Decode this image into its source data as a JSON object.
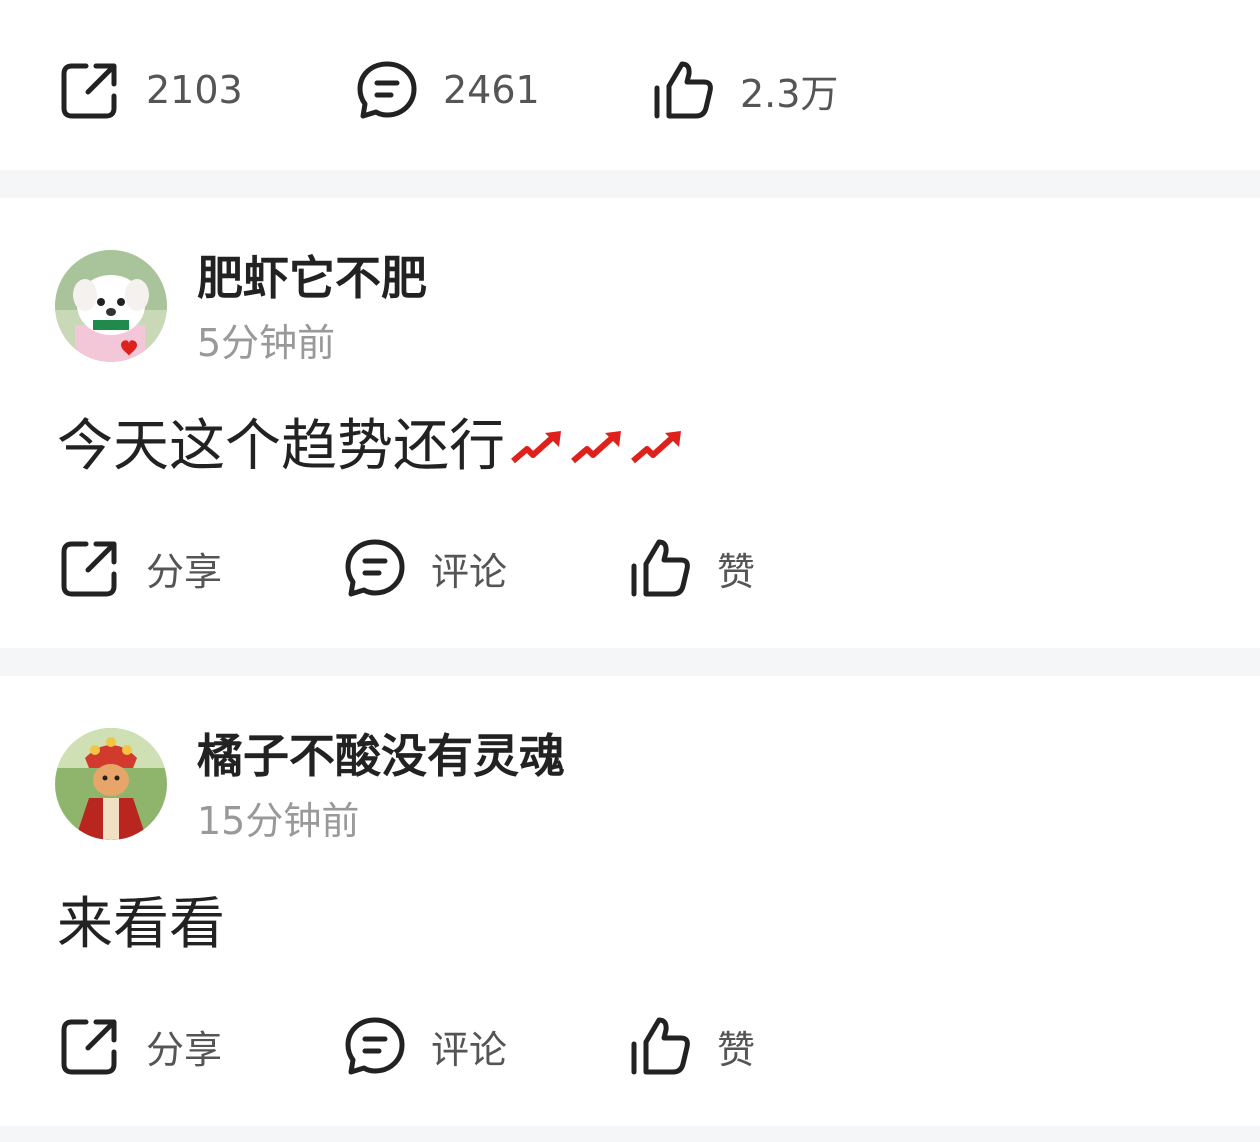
{
  "top_actions": {
    "share": "2103",
    "comment": "2461",
    "like": "2.3万"
  },
  "posts": [
    {
      "username": "肥虾它不肥",
      "time": "5分钟前",
      "content": "今天这个趋势还行",
      "actions": {
        "share": "分享",
        "comment": "评论",
        "like": "赞"
      }
    },
    {
      "username": "橘子不酸没有灵魂",
      "time": "15分钟前",
      "content": "来看看",
      "actions": {
        "share": "分享",
        "comment": "评论",
        "like": "赞"
      }
    }
  ],
  "colors": {
    "separator": "#f5f6f7",
    "trend": "#e0201b",
    "muted": "#999999"
  }
}
